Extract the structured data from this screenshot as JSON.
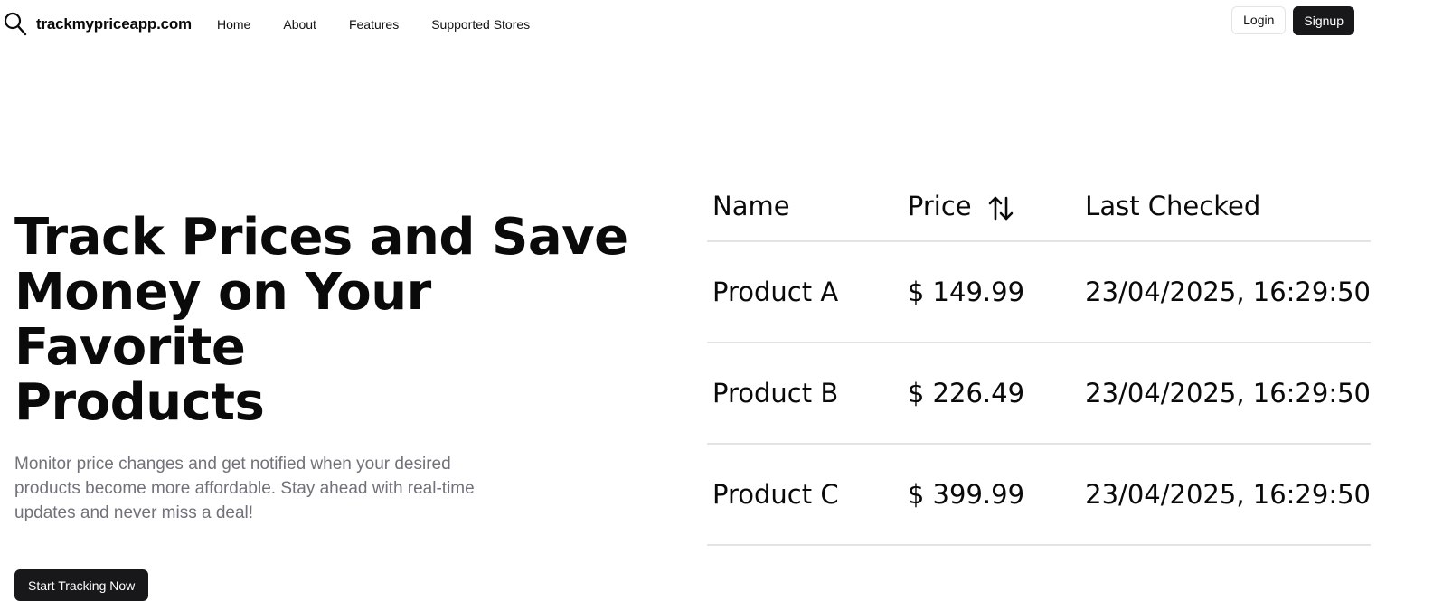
{
  "brand": {
    "name": "trackmypriceapp.com",
    "icon": "search-icon"
  },
  "nav": {
    "links": [
      "Home",
      "About",
      "Features",
      "Supported Stores"
    ]
  },
  "auth": {
    "login_label": "Login",
    "signup_label": "Signup"
  },
  "hero": {
    "title_lines": [
      "Track Prices and Save",
      "Money on Your Favorite",
      "Products"
    ],
    "description": "Monitor price changes and get notified when your desired products become more affordable. Stay ahead with real-time updates and never miss a deal!",
    "cta_label": "Start Tracking Now"
  },
  "table": {
    "headers": {
      "name": "Name",
      "price": "Price",
      "last_checked": "Last Checked"
    },
    "sort_icon": "sort-arrows-icon",
    "rows": [
      {
        "name": "Product A",
        "price": "$ 149.99",
        "last_checked": "23/04/2025, 16:29:50"
      },
      {
        "name": "Product B",
        "price": "$ 226.49",
        "last_checked": "23/04/2025, 16:29:50"
      },
      {
        "name": "Product C",
        "price": "$ 399.99",
        "last_checked": "23/04/2025, 16:29:50"
      }
    ]
  },
  "colors": {
    "primary_dark": "#18181b",
    "muted_text": "#71717a",
    "border": "#e4e4e7"
  }
}
